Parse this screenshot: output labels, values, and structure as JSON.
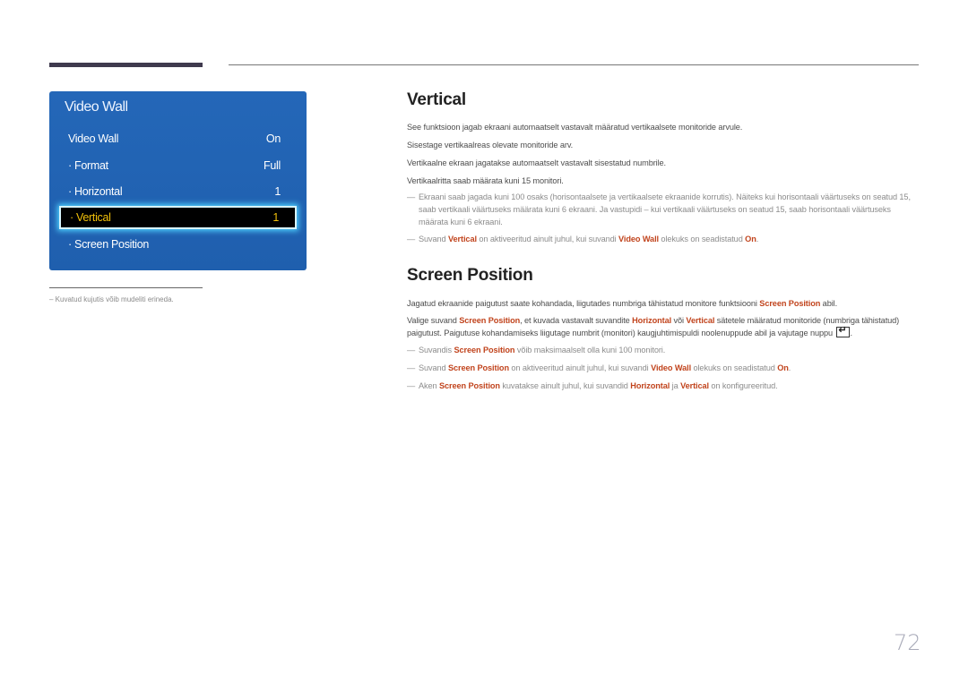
{
  "osd": {
    "title": "Video Wall",
    "rows": [
      {
        "label": "Video Wall",
        "value": "On"
      },
      {
        "label": "· Format",
        "value": "Full"
      },
      {
        "label": "· Horizontal",
        "value": "1"
      },
      {
        "label": "· Vertical",
        "value": "1"
      },
      {
        "label": "· Screen Position",
        "value": ""
      }
    ],
    "selected_index": 3
  },
  "footnote": "–  Kuvatud kujutis võib mudeliti erineda.",
  "vertical": {
    "heading": "Vertical",
    "paragraphs": [
      "See funktsioon jagab ekraani automaatselt vastavalt määratud vertikaalsete monitoride arvule.",
      "Sisestage vertikaalreas olevate monitoride arv.",
      "Vertikaalne ekraan jagatakse automaatselt vastavalt sisestatud numbrile.",
      "Vertikaalritta saab määrata kuni 15 monitori."
    ],
    "note1": "Ekraani saab jagada kuni 100 osaks (horisontaalsete ja vertikaalsete ekraanide korrutis). Näiteks kui horisontaali väärtuseks on seatud 15, saab vertikaali väärtuseks määrata kuni 6 ekraani. Ja vastupidi – kui vertikaali väärtuseks on seatud 15, saab horisontaali väärtuseks määrata kuni 6 ekraani.",
    "note2": {
      "t1": "Suvand ",
      "h1": "Vertical",
      "t2": " on aktiveeritud ainult juhul, kui suvandi ",
      "h2": "Video Wall",
      "t3": " olekuks on seadistatud ",
      "h3": "On",
      "t4": "."
    }
  },
  "screen_position": {
    "heading": "Screen Position",
    "p1": {
      "t1": "Jagatud ekraanide paigutust saate kohandada, liigutades numbriga tähistatud monitore funktsiooni ",
      "h1": "Screen Position",
      "t2": " abil."
    },
    "p2": {
      "t1": "Valige suvand ",
      "h1": "Screen Position",
      "t2": ", et kuvada vastavalt suvandite ",
      "h2": "Horizontal",
      "t3": " või ",
      "h3": "Vertical",
      "t4": " sätetele määratud monitoride (numbriga tähistatud) paigutust. Paigutuse kohandamiseks liigutage numbrit (monitori) kaugjuhtimispuldi noolenuppude abil ja vajutage nuppu ",
      "icon": "enter-button-icon",
      "t5": "."
    },
    "note1": {
      "t1": "Suvandis ",
      "h1": "Screen Position",
      "t2": " võib maksimaalselt olla kuni 100 monitori."
    },
    "note2": {
      "t1": "Suvand ",
      "h1": "Screen Position",
      "t2": " on aktiveeritud ainult juhul, kui suvandi ",
      "h2": "Video Wall",
      "t3": " olekuks on seadistatud ",
      "h3": "On",
      "t4": "."
    },
    "note3": {
      "t1": "Aken ",
      "h1": "Screen Position",
      "t2": " kuvatakse ainult juhul, kui suvandid ",
      "h2": "Horizontal",
      "t3": " ja ",
      "h3": "Vertical",
      "t4": " on konfigureeritud."
    }
  },
  "note_dash": "―",
  "page_number": "72",
  "colors": {
    "osd_blue": "#2467b8",
    "highlight_text": "#c1441d",
    "selected_text": "#f2c10a"
  }
}
